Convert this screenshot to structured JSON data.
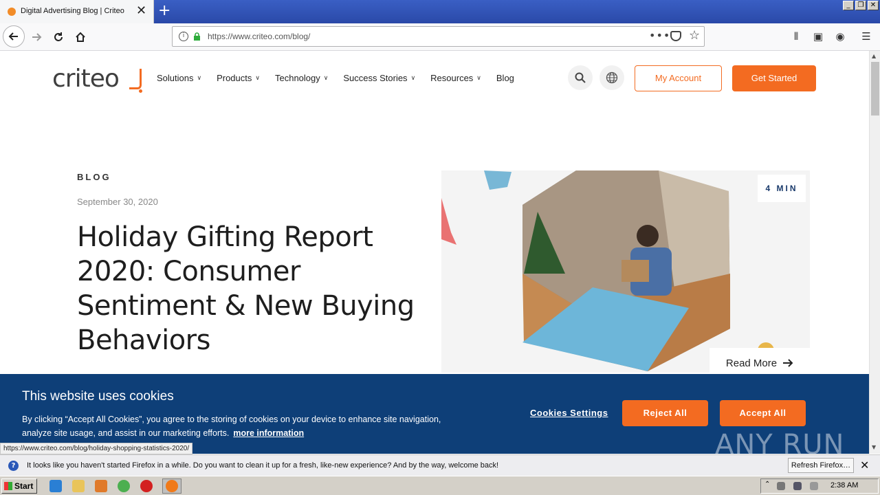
{
  "browser": {
    "tab_title": "Digital Advertising Blog | Criteo",
    "url": "https://www.criteo.com/blog/",
    "status_url": "https://www.criteo.com/blog/holiday-shopping-statistics-2020/"
  },
  "site": {
    "logo": "criteo",
    "nav": [
      {
        "label": "Solutions",
        "has_menu": true
      },
      {
        "label": "Products",
        "has_menu": true
      },
      {
        "label": "Technology",
        "has_menu": true
      },
      {
        "label": "Success Stories",
        "has_menu": true
      },
      {
        "label": "Resources",
        "has_menu": true
      },
      {
        "label": "Blog",
        "has_menu": false
      }
    ],
    "my_account": "My Account",
    "get_started": "Get Started"
  },
  "article": {
    "kicker": "BLOG",
    "date": "September 30, 2020",
    "title": "Holiday Gifting Report 2020: Consumer Sentiment & New Buying Behaviors",
    "read_time": "4 MIN",
    "read_more": "Read More"
  },
  "cookie": {
    "title": "This website uses cookies",
    "text": "By clicking “Accept All Cookies”, you agree to the storing of cookies on your device to enhance site navigation, analyze site usage, and assist in our marketing efforts.",
    "more_link": "more information",
    "settings": "Cookies Settings",
    "reject": "Reject All",
    "accept": "Accept All"
  },
  "notification": {
    "message": "It looks like you haven't started Firefox in a while. Do you want to clean it up for a fresh, like-new experience? And by the way, welcome back!",
    "button": "Refresh Firefox…"
  },
  "watermark": "ANY RUN",
  "taskbar": {
    "start": "Start",
    "clock": "2:38 AM"
  },
  "colors": {
    "brand_orange": "#f36b21",
    "cookie_bg": "#0e3f78"
  }
}
